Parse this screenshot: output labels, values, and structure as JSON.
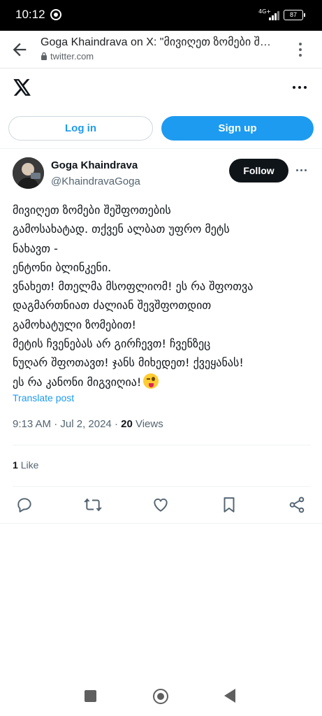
{
  "status_bar": {
    "time": "10:12",
    "network": "4G+",
    "battery": "87"
  },
  "browser": {
    "page_title": "Goga Khaindrava on X: \"მივიღეთ ზომები შეშფოთების გამოსახატად...\"",
    "url": "twitter.com"
  },
  "header": {
    "login_label": "Log in",
    "signup_label": "Sign up"
  },
  "tweet": {
    "author_name": "Goga Khaindrava",
    "author_handle": "@KhaindravaGoga",
    "follow_label": "Follow",
    "text_lines": [
      "მივიღეთ ზომები შეშფოთების",
      "გამოსახატად. თქვენ ალბათ უფრო მეტს",
      "ნახავთ -",
      "ენტონი ბლინკენი.",
      "ვნახეთ! მთელმა მსოფლიომ! ეს რა შფოთვა",
      "დაგმართნიათ ძალიან შევშფოთდით",
      "გამოხატული ზომებით!",
      "მეტის ჩვენებას არ გირჩევთ! ჩვენზეც",
      "ნუღარ შფოთავთ! ჯანს მიხედეთ! ქვეყანას!",
      "ეს რა კანონი მიგვიღია!"
    ],
    "translate_label": "Translate post",
    "time": "9:13 AM",
    "date": "Jul 2, 2024",
    "views_count": "20",
    "views_label": "Views",
    "likes_count": "1",
    "likes_label": "Like"
  },
  "colors": {
    "accent": "#1d9bf0",
    "text": "#0f1419",
    "secondary": "#536471"
  }
}
